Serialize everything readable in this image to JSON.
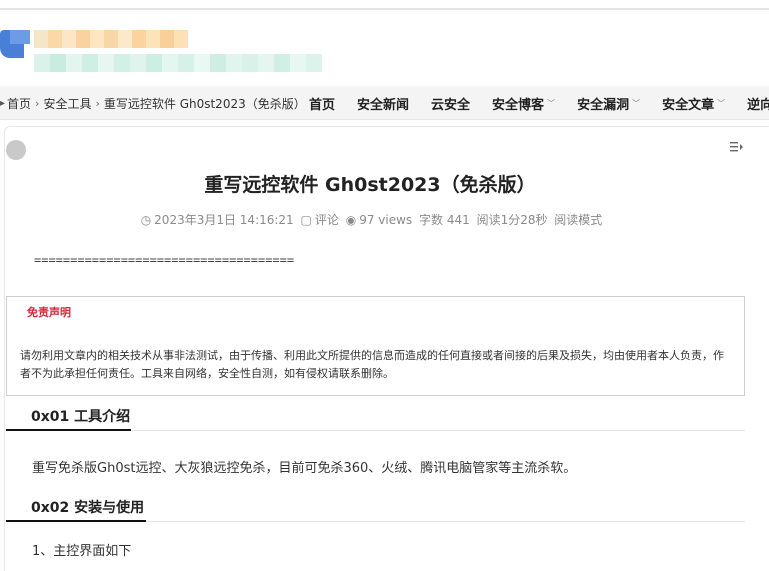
{
  "breadcrumb": {
    "items": [
      "首页",
      "安全工具",
      "重写远控软件 Gh0st2023（免杀版）"
    ]
  },
  "nav": {
    "items": [
      {
        "label": "首页",
        "dropdown": false
      },
      {
        "label": "安全新闻",
        "dropdown": false
      },
      {
        "label": "云安全",
        "dropdown": false
      },
      {
        "label": "安全博客",
        "dropdown": true
      },
      {
        "label": "安全漏洞",
        "dropdown": true
      },
      {
        "label": "安全文章",
        "dropdown": true
      },
      {
        "label": "逆向",
        "dropdown": false
      }
    ]
  },
  "article": {
    "title": "重写远控软件 Gh0st2023（免杀版）",
    "meta": {
      "date": "2023年3月1日 14:16:21",
      "comments": "评论",
      "views": "97 views",
      "words": "字数 441",
      "read_time": "阅读1分28秒",
      "read_mode": "阅读模式"
    },
    "separator": "====================================",
    "disclaimer": {
      "title": "免责声明",
      "text": "请勿利用文章内的相关技术从事非法测试，由于传播、利用此文所提供的信息而造成的任何直接或者间接的后果及损失，均由使用者本人负责，作者不为此承担任何责任。工具来自网络，安全性自测，如有侵权请联系删除。"
    },
    "sections": [
      {
        "heading": "0x01 工具介绍",
        "body": "重写免杀版Gh0st远控、大灰狼远控免杀，目前可免杀360、火绒、腾讯电脑管家等主流杀软。"
      },
      {
        "heading": "0x02 安装与使用",
        "body": "1、主控界面如下"
      }
    ]
  },
  "colors": {
    "accent_red": "#d22a3d",
    "nav_bg": "#f4f4f4",
    "logo_blue": "#4a7fd8"
  }
}
